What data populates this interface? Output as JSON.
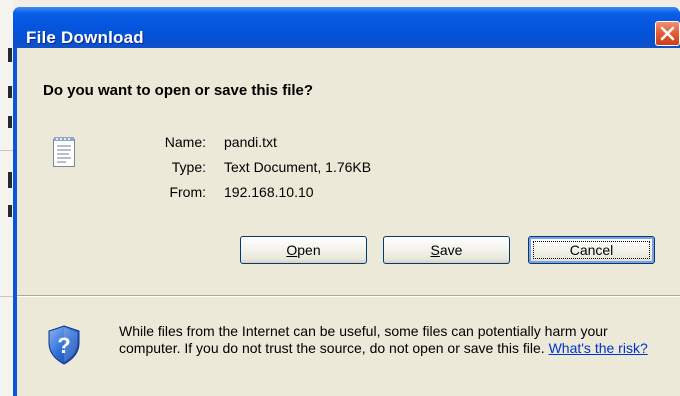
{
  "dialog": {
    "title": "File Download",
    "question": "Do you want to open or save this file?",
    "icons": {
      "file": "text-file-icon",
      "close": "close-icon",
      "security": "security-shield-question-icon"
    },
    "file_info": {
      "name_label": "Name:",
      "name_value": "pandi.txt",
      "type_label": "Type:",
      "type_value": "Text Document, 1.76KB",
      "from_label": "From:",
      "from_value": "192.168.10.10"
    },
    "buttons": {
      "open_mnemonic": "O",
      "open_rest": "pen",
      "save_mnemonic": "S",
      "save_rest": "ave",
      "cancel": "Cancel"
    },
    "warning": {
      "text": "While files from the Internet can be useful, some files can potentially harm your computer. If you do not trust the source, do not open or save this file. ",
      "link": "What's the risk?"
    },
    "colors": {
      "titlebar": "#0453d8",
      "client_background": "#ece9d8",
      "close_button": "#e2552e",
      "link": "#0033cc"
    }
  }
}
